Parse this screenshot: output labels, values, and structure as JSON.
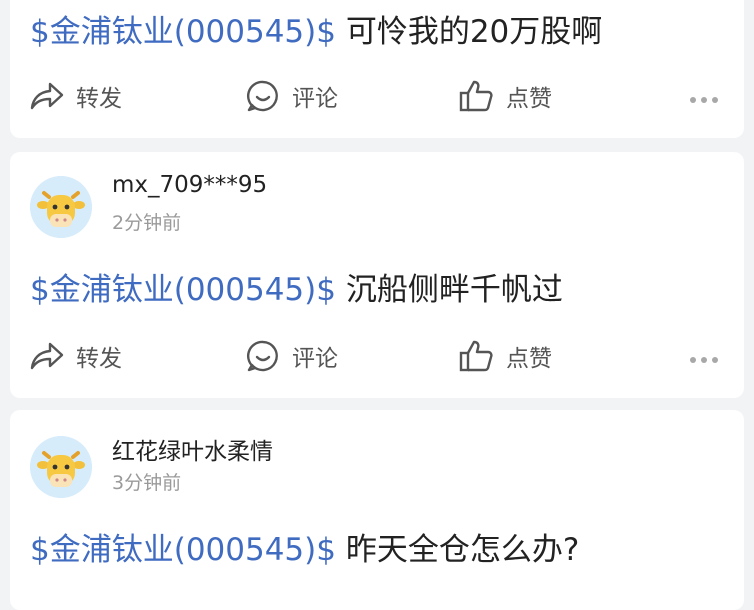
{
  "posts": [
    {
      "stock": "$金浦钛业(000545)$",
      "text": " 可怜我的20万股啊",
      "actions": {
        "forward": "转发",
        "comment": "评论",
        "like": "点赞"
      }
    },
    {
      "user": "mx_709***95",
      "time": "2分钟前",
      "stock": "$金浦钛业(000545)$",
      "text": " 沉船侧畔千帆过",
      "actions": {
        "forward": "转发",
        "comment": "评论",
        "like": "点赞"
      }
    },
    {
      "user": "红花绿叶水柔情",
      "time": "3分钟前",
      "stock": "$金浦钛业(000545)$",
      "text": " 昨天全仓怎么办?"
    }
  ],
  "icons": [
    "forward-icon",
    "comment-icon",
    "like-icon",
    "more-icon",
    "cow-avatar-icon"
  ],
  "colors": {
    "stock_link": "#3f6bc1",
    "background": "#f2f3f5",
    "card": "#ffffff",
    "muted": "#9a9a9a"
  }
}
